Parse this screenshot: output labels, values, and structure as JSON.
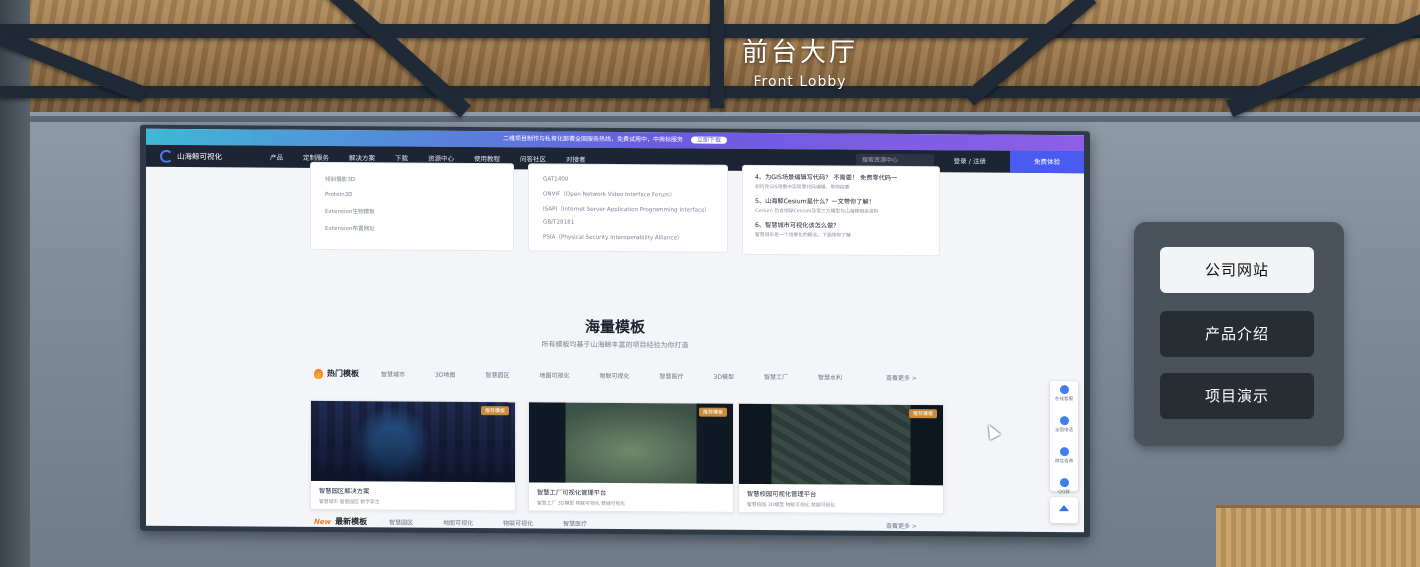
{
  "scene": {
    "sign_title": "前台大厅",
    "sign_subtitle": "Front Lobby"
  },
  "screen": {
    "banner": {
      "text": "二维项目制作与私有化部署全国服务热线，免费试用中，中商标服务",
      "button": "立即下载"
    },
    "navbar": {
      "logo_text": "山海鲸可视化",
      "items": [
        "产品",
        "定制服务",
        "解决方案",
        "下载",
        "资源中心",
        "使用教程",
        "问答社区",
        "对接者"
      ],
      "search_placeholder": "搜索资源中心",
      "login_label": "登录 / 注册",
      "cta_label": "免费体验"
    },
    "left_list": [
      "倾斜摄影3D",
      "Protein3D",
      "Extension生物模板",
      "Extension布置网址"
    ],
    "mid_list": [
      "GAT1400",
      "ONVIF（Open Network Video Interface Forum）",
      "ISAPI（Internet Server Application Programming Interface）",
      "GB/T28181",
      "PSIA（Physical Security Interoperability Alliance）"
    ],
    "news": [
      {
        "title": "4、为GIS场景编辑写代码？ 不需要！ 免费零代码一",
        "sub": "如何在GIS场景中实现零代码编辑，带你探索"
      },
      {
        "title": "5、山海鲸Cesium是什么？一文带你了解！",
        "sub": "Cesium 包含地球Cesium及第三方模型与山海鲸相关资料"
      },
      {
        "title": "6、智慧城市可视化该怎么做？",
        "sub": "智慧城市是一个场景化的概念，下面带你了解"
      }
    ],
    "section": {
      "title": "海量模板",
      "subtitle": "所有模板均基于山海鲸丰富的项目经验为你打造"
    },
    "hot_row": {
      "label": "热门模板",
      "tabs": [
        "智慧城市",
        "3D地图",
        "智慧园区",
        "地图可视化",
        "物联可视化",
        "智慧医疗",
        "3D模型",
        "智慧工厂",
        "智慧水利"
      ],
      "more": "查看更多 >"
    },
    "new_row": {
      "badge": "New",
      "label": "最新模板",
      "tabs": [
        "智慧园区",
        "地图可视化",
        "物联可视化",
        "智慧医疗"
      ],
      "more": "查看更多 >"
    },
    "templates": [
      {
        "title": "智慧园区解决方案",
        "tags": "智慧城市 智慧园区 数字孪生",
        "badge": "推荐模板"
      },
      {
        "title": "智慧工厂可视化管理平台",
        "tags": "智慧工厂 3D模型 物联可视化 数据可视化",
        "badge": "推荐模板"
      },
      {
        "title": "智慧校园可视化管理平台",
        "tags": "智慧校园 3D模型 物联可视化 数据可视化",
        "badge": "推荐模板"
      }
    ],
    "float_bar": [
      "在线客服",
      "全国电话",
      "微信咨询",
      "QQ群"
    ]
  },
  "menu": {
    "buttons": [
      "公司网站",
      "产品介绍",
      "项目演示"
    ],
    "active_index": 0
  }
}
